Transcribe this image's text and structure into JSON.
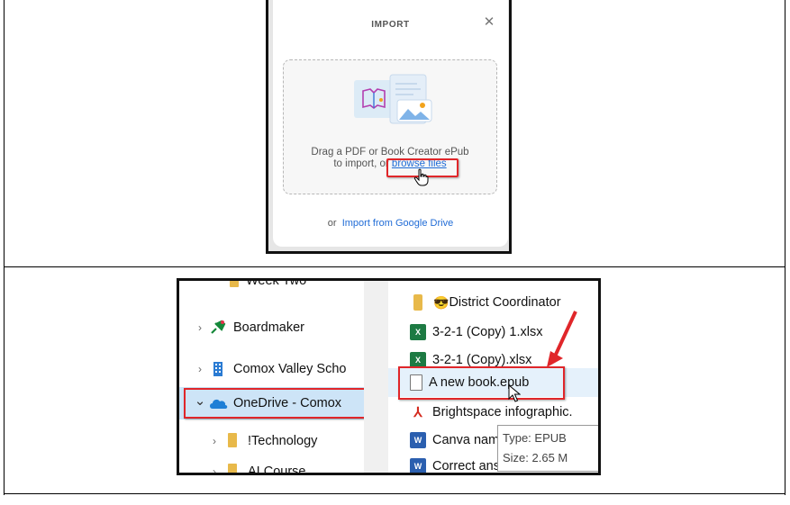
{
  "import_dialog": {
    "title": "IMPORT",
    "close_glyph": "✕",
    "drop_line1": "Drag a PDF or Book Creator ePub",
    "drop_line2_prefix": "to import, or ",
    "browse_link": "browse files",
    "or_text": "or",
    "gdrive_link": "Import from Google Drive",
    "icons": [
      "book-illustration-icon",
      "image-document-icon",
      "hand-cursor-icon",
      "close-icon"
    ]
  },
  "explorer": {
    "nav": [
      {
        "label": "Week Two",
        "icon": "folder-icon",
        "chevron": ""
      },
      {
        "label": "Boardmaker",
        "icon": "pushpin-icon",
        "chevron": "›"
      },
      {
        "label": "Comox Valley Scho",
        "icon": "building-icon",
        "chevron": "›"
      },
      {
        "label": "OneDrive - Comox",
        "icon": "cloud-icon",
        "chevron": "⌄"
      },
      {
        "label": "!Technology",
        "icon": "folder-icon",
        "chevron": "›"
      },
      {
        "label": "AI Course",
        "icon": "folder-icon",
        "chevron": "›"
      }
    ],
    "files": [
      {
        "label": "District Coordinator",
        "icon": "folder-icon",
        "prefix_emoji": "😎"
      },
      {
        "label": "3-2-1 (Copy) 1.xlsx",
        "icon": "excel-icon",
        "badge": "X"
      },
      {
        "label": "3-2-1 (Copy).xlsx",
        "icon": "excel-icon",
        "badge": "X"
      },
      {
        "label": "A new book.epub",
        "icon": "blank-file-icon",
        "badge": ""
      },
      {
        "label": "Brightspace infographic.",
        "icon": "pdf-icon",
        "badge": "⅄"
      },
      {
        "label": "Canva name",
        "icon": "word-icon",
        "badge": "W"
      },
      {
        "label": "Correct ansv",
        "icon": "word-icon",
        "badge": "W"
      }
    ],
    "tooltip": {
      "type_line": "Type: EPUB",
      "size_line": "Size: 2.65 M"
    }
  },
  "colors": {
    "highlight_red": "#e0262a",
    "link_blue": "#1f6bd6",
    "selected_blue": "#cde4f7",
    "hover_blue": "#e5f1fb",
    "excel_green": "#1d7a43",
    "word_blue": "#2b5faf",
    "folder_yellow": "#e8b94a",
    "onedrive_blue": "#1e7fd6"
  }
}
